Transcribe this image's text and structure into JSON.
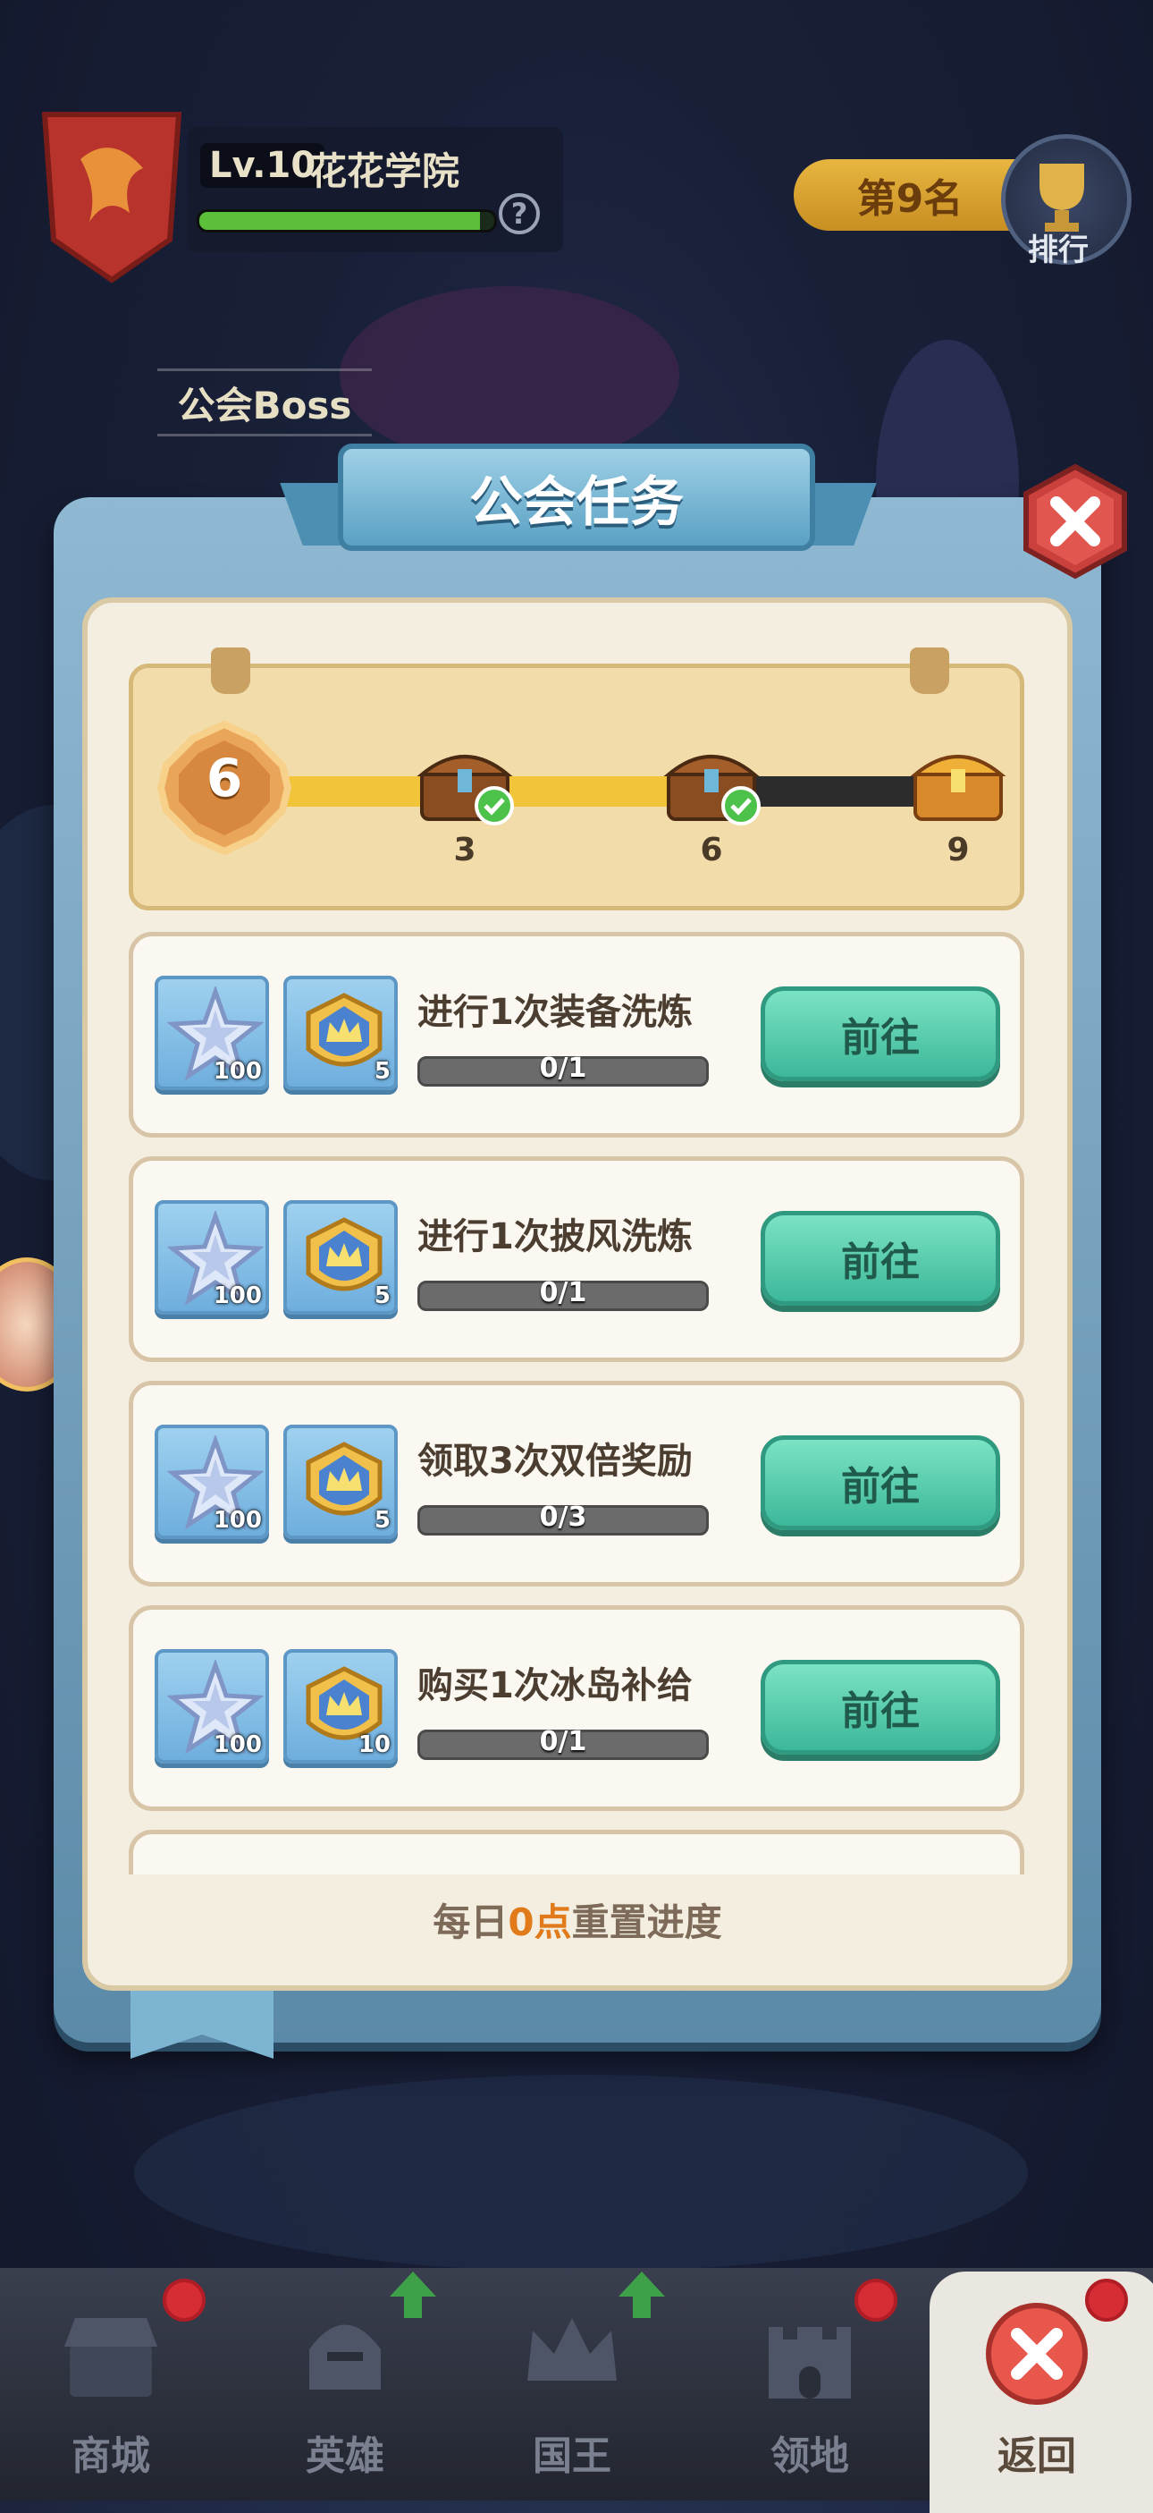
{
  "header": {
    "guild_level": "Lv.10",
    "guild_name": "花花学院",
    "guild_xp_fraction": 0.95,
    "help_glyph": "?",
    "rank_text": "第9名",
    "rank_label": "排行",
    "boss_label": "公会Boss"
  },
  "panel": {
    "title": "公会任务",
    "close_icon": "close-x-icon"
  },
  "chest_progress": {
    "current_points": "6",
    "fill_fraction": 0.62,
    "milestones": [
      {
        "value": "3",
        "claimed": true
      },
      {
        "value": "6",
        "claimed": true
      },
      {
        "value": "9",
        "claimed": false
      }
    ]
  },
  "tasks": [
    {
      "name": "进行1次装备洗炼",
      "progress": "0/1",
      "rewards": [
        {
          "icon": "star-gem-icon",
          "count": "100"
        },
        {
          "icon": "crown-badge-icon",
          "count": "5"
        }
      ],
      "button": "前往"
    },
    {
      "name": "进行1次披风洗炼",
      "progress": "0/1",
      "rewards": [
        {
          "icon": "star-gem-icon",
          "count": "100"
        },
        {
          "icon": "crown-badge-icon",
          "count": "5"
        }
      ],
      "button": "前往"
    },
    {
      "name": "领取3次双倍奖励",
      "progress": "0/3",
      "rewards": [
        {
          "icon": "star-gem-icon",
          "count": "100"
        },
        {
          "icon": "crown-badge-icon",
          "count": "5"
        }
      ],
      "button": "前往"
    },
    {
      "name": "购买1次冰岛补给",
      "progress": "0/1",
      "rewards": [
        {
          "icon": "star-gem-icon",
          "count": "100"
        },
        {
          "icon": "crown-badge-icon",
          "count": "10"
        }
      ],
      "button": "前往"
    }
  ],
  "footer_note": {
    "prefix": "每日",
    "highlight": "0点",
    "suffix": "重置进度"
  },
  "nav": [
    {
      "label": "商城",
      "icon": "shop-icon",
      "badge": "red-dot"
    },
    {
      "label": "英雄",
      "icon": "helmet-icon",
      "badge": "up-arrow"
    },
    {
      "label": "国王",
      "icon": "crown-icon",
      "badge": "up-arrow"
    },
    {
      "label": "领地",
      "icon": "castle-icon",
      "badge": "red-dot"
    },
    {
      "label": "返回",
      "icon": "back-x-icon",
      "badge": "red-dot"
    }
  ],
  "colors": {
    "accent_green": "#3cb899",
    "progress_yellow": "#f2c43a",
    "highlight_orange": "#e07a1a",
    "panel_blue": "#5b8aa8"
  }
}
